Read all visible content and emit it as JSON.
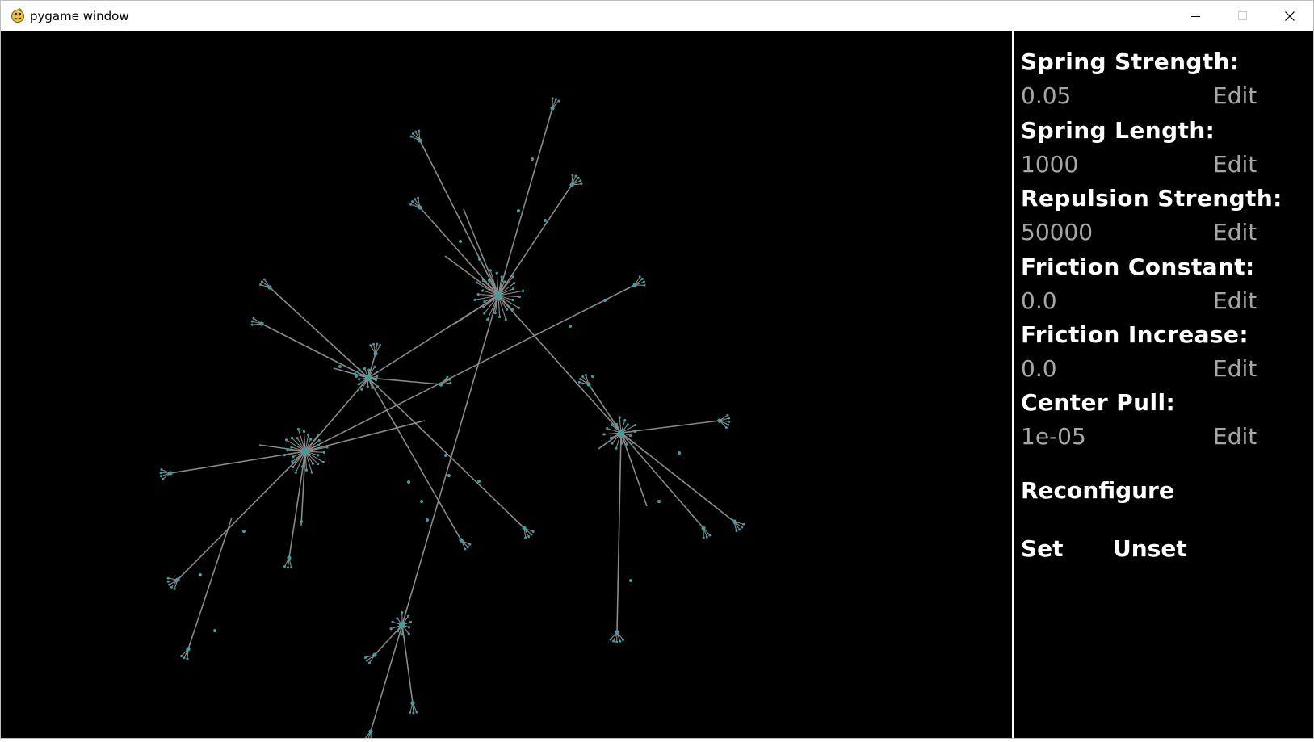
{
  "window": {
    "title": "pygame window",
    "app_icon": "pygame-snake-icon",
    "controls": [
      "minimize-icon",
      "maximize-icon",
      "close-icon"
    ]
  },
  "graph": {
    "background": "#000000",
    "edge_color": "#8a8a8a",
    "node_color": "#3f9f9f",
    "description": ""
  },
  "panel": {
    "params": [
      {
        "label": "Spring Strength:",
        "value": "0.05",
        "edit": "Edit"
      },
      {
        "label": "Spring Length:",
        "value": "1000",
        "edit": "Edit"
      },
      {
        "label": "Repulsion Strength:",
        "value": "50000",
        "edit": "Edit"
      },
      {
        "label": "Friction Constant:",
        "value": "0.0",
        "edit": "Edit"
      },
      {
        "label": "Friction Increase:",
        "value": "0.0",
        "edit": "Edit"
      },
      {
        "label": "Center Pull:",
        "value": "1e-05",
        "edit": "Edit"
      }
    ],
    "reconfigure": "Reconfigure",
    "set": "Set",
    "unset": "Unset"
  },
  "colors": {
    "label": "#ffffff",
    "value": "#a6a6a6",
    "divider": "#ffffff"
  }
}
